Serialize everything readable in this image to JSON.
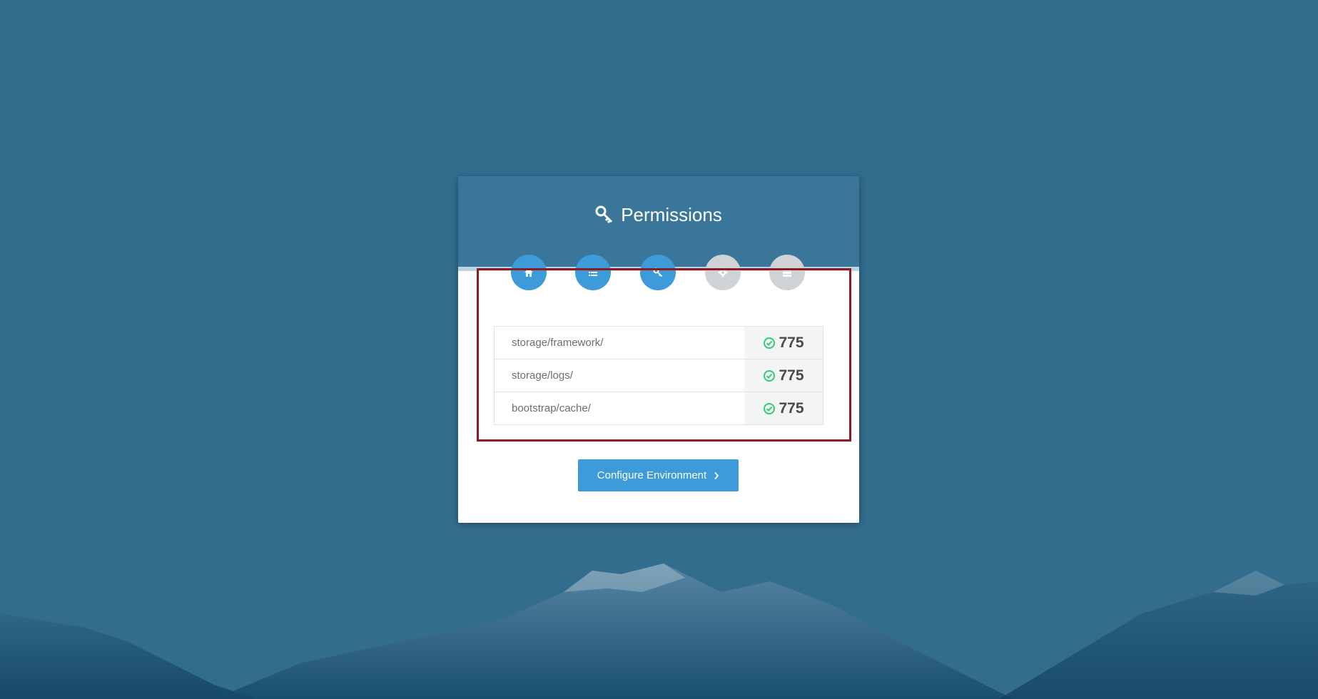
{
  "page": {
    "title": "Permissions",
    "title_icon": "key-icon"
  },
  "steps": [
    {
      "icon": "home-icon",
      "state": "active"
    },
    {
      "icon": "list-icon",
      "state": "active"
    },
    {
      "icon": "key-icon",
      "state": "active"
    },
    {
      "icon": "gear-icon",
      "state": "inactive"
    },
    {
      "icon": "server-icon",
      "state": "inactive"
    }
  ],
  "permissions": [
    {
      "path": "storage/framework/",
      "value": "775",
      "status": "ok"
    },
    {
      "path": "storage/logs/",
      "value": "775",
      "status": "ok"
    },
    {
      "path": "bootstrap/cache/",
      "value": "775",
      "status": "ok"
    }
  ],
  "actions": {
    "next_label": "Configure Environment"
  },
  "colors": {
    "background": "#336d8e",
    "header": "#3a7699",
    "accent": "#3c9bd8",
    "inactive_step": "#cfd3d6",
    "success": "#2ecc71",
    "highlight_border": "#8e1b23"
  }
}
